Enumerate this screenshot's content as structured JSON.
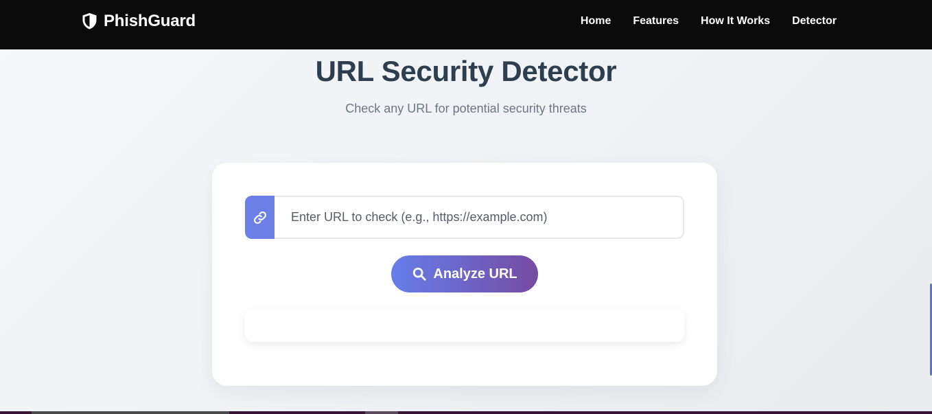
{
  "brand": {
    "name": "PhishGuard",
    "icon": "shield-icon"
  },
  "nav": {
    "items": [
      {
        "label": "Home"
      },
      {
        "label": "Features"
      },
      {
        "label": "How It Works"
      },
      {
        "label": "Detector"
      }
    ]
  },
  "hero": {
    "title": "URL Security Detector",
    "subtitle": "Check any URL for potential security threats"
  },
  "detector": {
    "input_icon": "link-icon",
    "input_placeholder": "Enter URL to check (e.g., https://example.com)",
    "input_value": "",
    "button_icon": "search-icon",
    "button_label": "Analyze URL",
    "result_text": ""
  },
  "colors": {
    "navbar": "#0b0b0b",
    "accent_start": "#667eea",
    "accent_end": "#764ba2",
    "title": "#2c3e50",
    "subtitle": "#6c7785"
  }
}
